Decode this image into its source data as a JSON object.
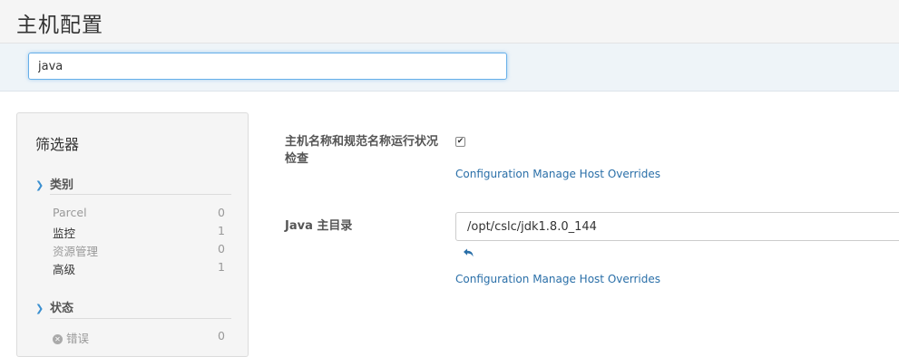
{
  "header": {
    "title": "主机配置"
  },
  "search": {
    "value": "java"
  },
  "filters": {
    "title": "筛选器",
    "groups": [
      {
        "label": "类别",
        "items": [
          {
            "label": "Parcel",
            "count": "0"
          },
          {
            "label": "监控",
            "count": "1"
          },
          {
            "label": "资源管理",
            "count": "0"
          },
          {
            "label": "高级",
            "count": "1"
          }
        ]
      },
      {
        "label": "状态",
        "items": [
          {
            "label": "错误",
            "count": "0"
          }
        ]
      }
    ]
  },
  "settings": [
    {
      "label": "主机名称和规范名称运行状况检查",
      "checked": true,
      "link": "Configuration Manage Host Overrides"
    },
    {
      "label": "Java 主目录",
      "value": "/opt/cslc/jdk1.8.0_144",
      "link": "Configuration Manage Host Overrides"
    }
  ],
  "colors": {
    "accent": "#3a8fd0",
    "link": "#2a6fa8",
    "focus_border": "#66afe9"
  },
  "icons": {
    "group_expand": "chevron-down-icon",
    "error_status": "error-circle-icon",
    "checkbox_mark": "checkmark-icon",
    "revert": "undo-arrow-icon"
  }
}
